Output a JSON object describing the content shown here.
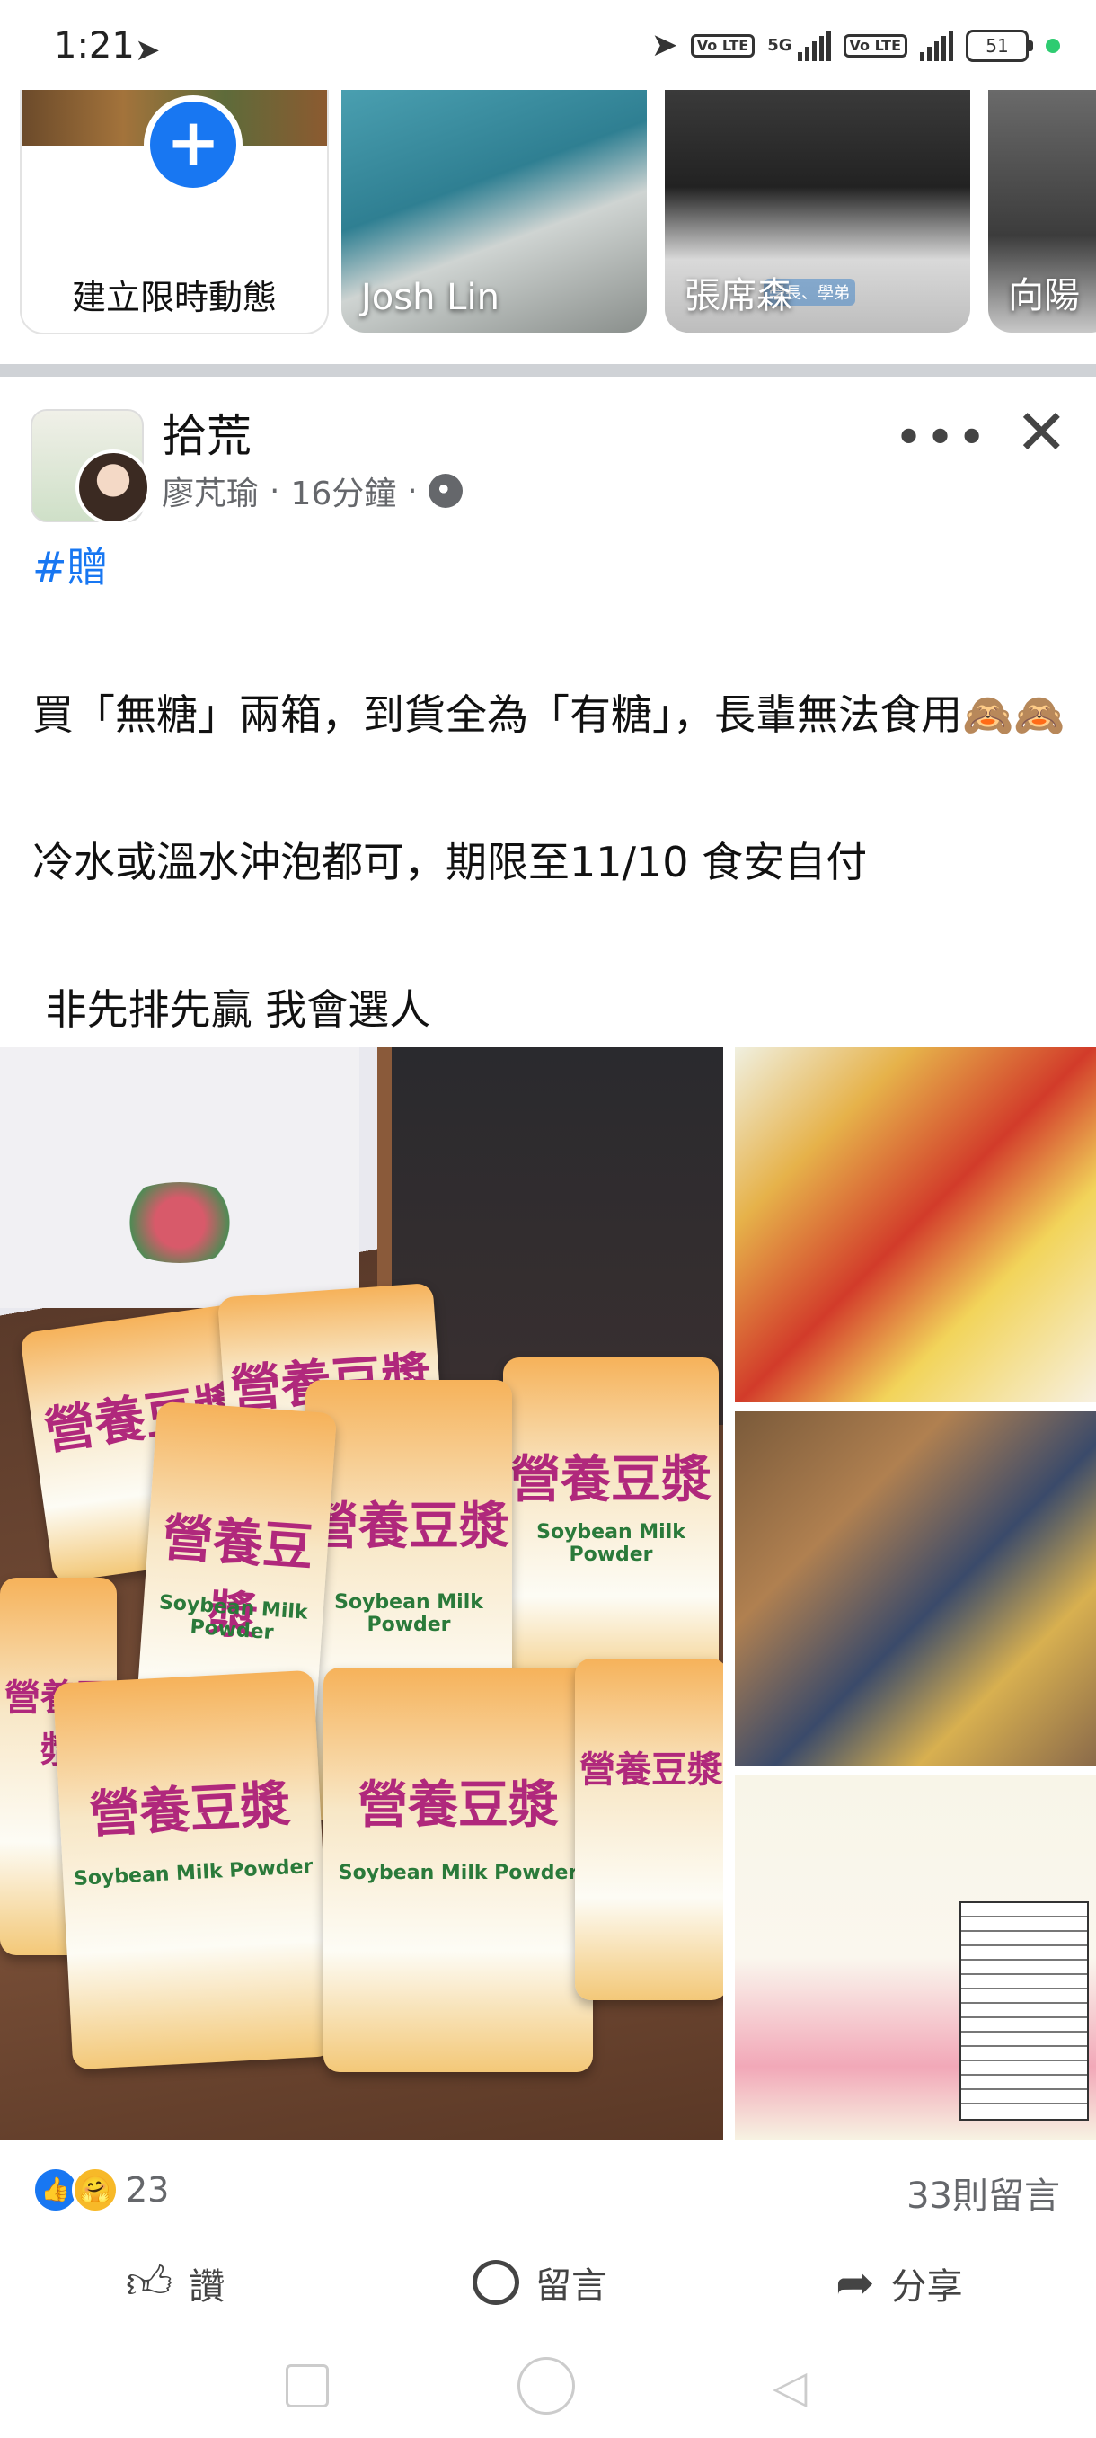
{
  "status_bar": {
    "time": "1:21",
    "network": "5G",
    "volte1": "Vo LTE",
    "volte2": "Vo LTE",
    "battery": "51"
  },
  "stories": {
    "create_label": "建立限時動態",
    "items": [
      {
        "name": "Josh Lin",
        "overlay": ""
      },
      {
        "name": "張席森",
        "overlay": "學長、學弟"
      },
      {
        "name": "向陽",
        "overlay": ""
      }
    ]
  },
  "post": {
    "group_name": "拾荒",
    "author": "廖芃瑜",
    "time": "16分鐘",
    "separator": "·",
    "hashtag": "#贈",
    "lines": [
      "買「無糖」兩箱，到貨全為「有糖」，長輩無法食用🙈🙈",
      "冷水或溫水沖泡都可，期限至11/10 食安自付",
      " 非先排先贏 我會選人"
    ],
    "product_label": "營養豆漿",
    "product_sub": "Soybean Milk Powder"
  },
  "reactions": {
    "count": "23",
    "like_icon": "👍",
    "care_icon": "🤗",
    "comments": "33則留言"
  },
  "actions": {
    "like": "讚",
    "comment": "留言",
    "share": "分享"
  }
}
